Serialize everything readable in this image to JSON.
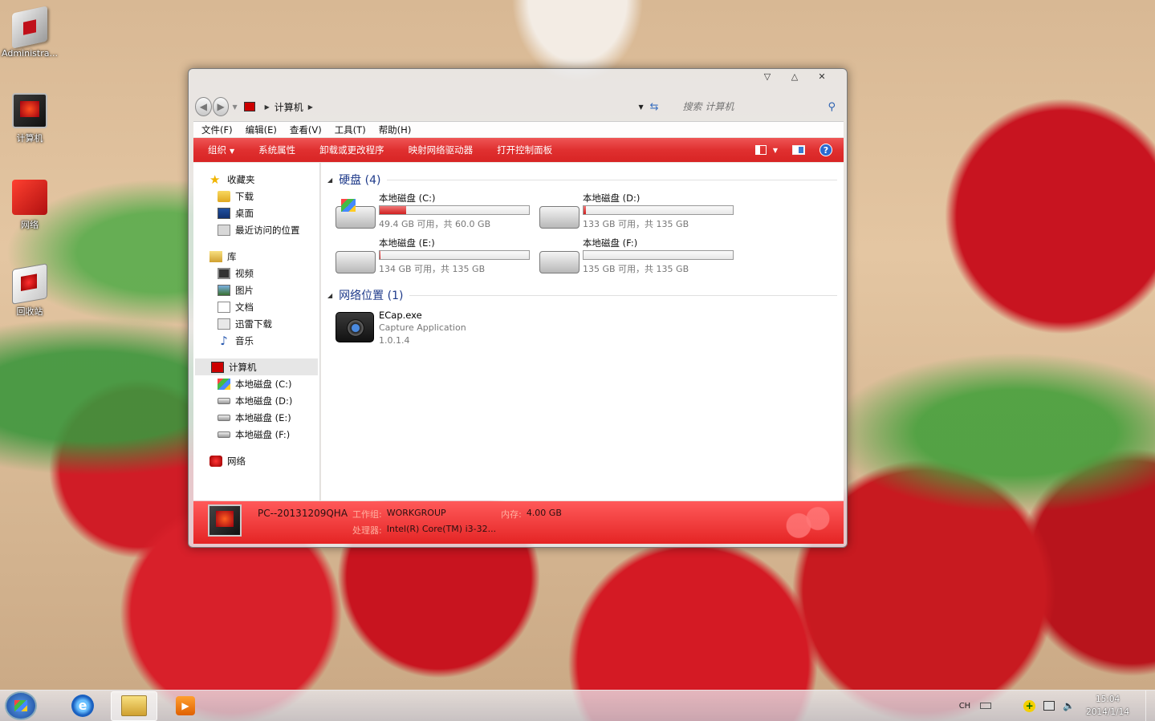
{
  "desktop": {
    "icons": [
      {
        "label": "Administra...",
        "icon": "user-folder-icon"
      },
      {
        "label": "计算机",
        "icon": "computer-icon"
      },
      {
        "label": "网络",
        "icon": "network-icon"
      },
      {
        "label": "回收站",
        "icon": "recycle-bin-icon"
      }
    ]
  },
  "window": {
    "controls": {
      "minimize": "▽",
      "maximize": "△",
      "close": "✕"
    },
    "address": {
      "back": "◀",
      "forward": "▶",
      "crumb": "计算机",
      "search_placeholder": "搜索 计算机"
    },
    "menu": [
      "文件(F)",
      "编辑(E)",
      "查看(V)",
      "工具(T)",
      "帮助(H)"
    ],
    "toolbar": {
      "organize": "组织",
      "items": [
        "系统属性",
        "卸载或更改程序",
        "映射网络驱动器",
        "打开控制面板"
      ]
    },
    "nav": {
      "favorites": {
        "label": "收藏夹",
        "items": [
          "下载",
          "桌面",
          "最近访问的位置"
        ]
      },
      "libraries": {
        "label": "库",
        "items": [
          "视频",
          "图片",
          "文档",
          "迅雷下载",
          "音乐"
        ]
      },
      "computer": {
        "label": "计算机",
        "items": [
          "本地磁盘 (C:)",
          "本地磁盘 (D:)",
          "本地磁盘 (E:)",
          "本地磁盘 (F:)"
        ]
      },
      "network": {
        "label": "网络"
      }
    },
    "content": {
      "hard_disks": {
        "header": "硬盘 (4)",
        "drives": [
          {
            "name": "本地磁盘 (C:)",
            "free": "49.4 GB 可用，共 60.0 GB",
            "used_fraction": 0.18,
            "system": true
          },
          {
            "name": "本地磁盘 (D:)",
            "free": "133 GB 可用，共 135 GB",
            "used_fraction": 0.015,
            "system": false
          },
          {
            "name": "本地磁盘 (E:)",
            "free": "134 GB 可用，共 135 GB",
            "used_fraction": 0.007,
            "system": false
          },
          {
            "name": "本地磁盘 (F:)",
            "free": "135 GB 可用，共 135 GB",
            "used_fraction": 0.0,
            "system": false
          }
        ]
      },
      "network_locations": {
        "header": "网络位置 (1)",
        "items": [
          {
            "name": "ECap.exe",
            "desc": "Capture Application",
            "version": "1.0.1.4"
          }
        ]
      }
    },
    "details": {
      "computer_name": "PC--20131209QHA",
      "workgroup_label": "工作组:",
      "workgroup": "WORKGROUP",
      "memory_label": "内存:",
      "memory": "4.00 GB",
      "cpu_label": "处理器:",
      "cpu": "Intel(R) Core(TM) i3-32..."
    }
  },
  "taskbar": {
    "tray": {
      "lang": "CH",
      "time": "15:04",
      "date": "2014/1/14"
    }
  }
}
